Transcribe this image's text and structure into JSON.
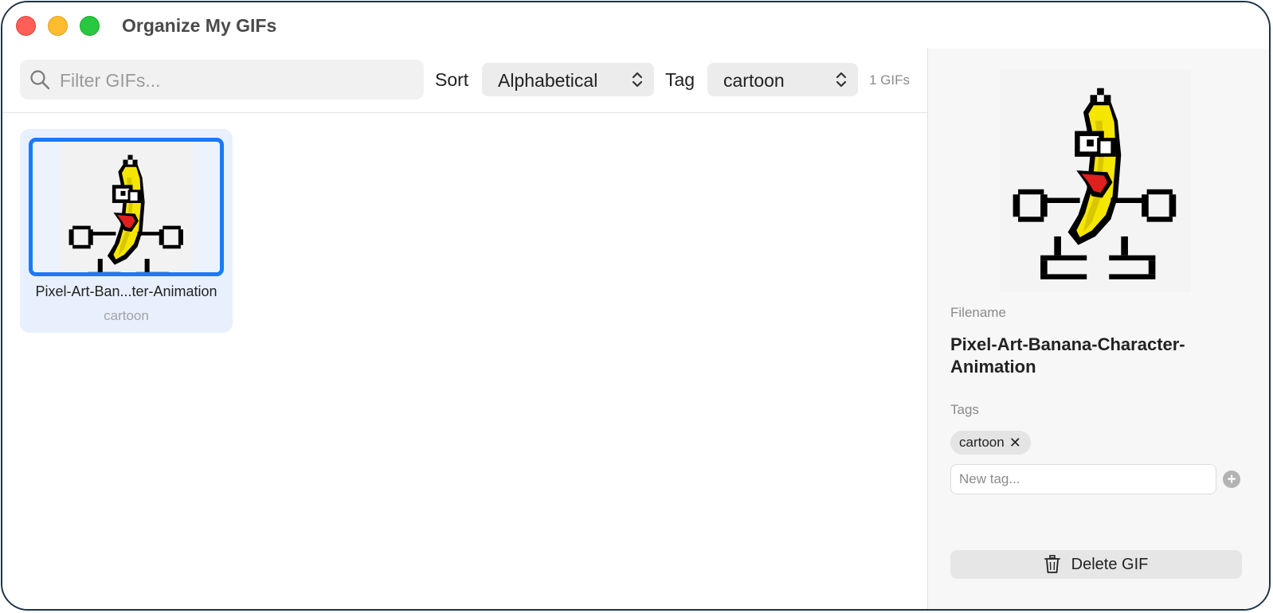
{
  "window": {
    "title": "Organize My GIFs"
  },
  "toolbar": {
    "search_placeholder": "Filter GIFs...",
    "search_value": "",
    "sort_label": "Sort",
    "sort_value": "Alphabetical",
    "tag_label": "Tag",
    "tag_value": "cartoon",
    "count_text": "1 GIFs"
  },
  "grid": {
    "items": [
      {
        "name": "Pixel-Art-Ban...ter-Animation",
        "tag": "cartoon",
        "selected": true
      }
    ]
  },
  "detail": {
    "filename_label": "Filename",
    "filename": "Pixel-Art-Banana-Character-Animation",
    "tags_label": "Tags",
    "tags": [
      "cartoon"
    ],
    "remove_glyph": "✕",
    "new_tag_placeholder": "New tag...",
    "add_glyph": "+",
    "delete_label": "Delete GIF"
  },
  "colors": {
    "accent": "#1a7af8",
    "selection_bg": "#e8f0fd",
    "close": "#ff5f57",
    "minimize": "#febc2e",
    "zoom": "#28c840",
    "banana_yellow": "#f5e600",
    "tongue_red": "#e01f1f"
  }
}
